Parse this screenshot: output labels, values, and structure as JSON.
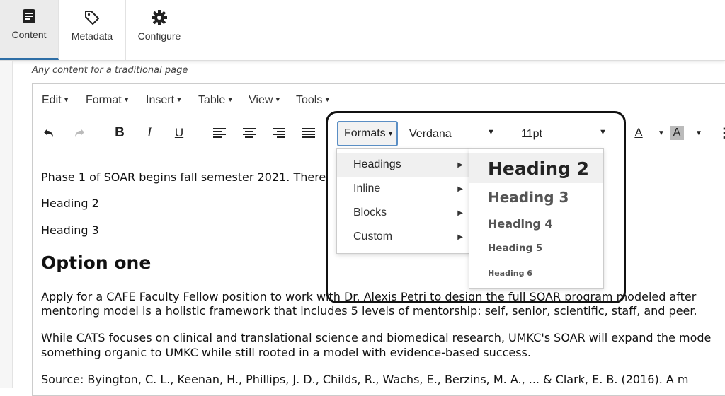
{
  "tabs": [
    {
      "label": "Content",
      "icon": "document-icon"
    },
    {
      "label": "Metadata",
      "icon": "tag-icon"
    },
    {
      "label": "Configure",
      "icon": "gear-icon"
    }
  ],
  "hint": "Any content for a traditional page",
  "menubar": [
    "Edit",
    "Format",
    "Insert",
    "Table",
    "View",
    "Tools"
  ],
  "toolbar": {
    "formats_label": "Formats",
    "font": "Verdana",
    "size": "11pt"
  },
  "content": {
    "p1": "Phase 1 of SOAR begins fall semester 2021. There",
    "heading2": "Heading 2",
    "heading3": "Heading 3",
    "option_one": "Option one",
    "p2a": "Apply for a CAFE Faculty Fellow position to work with Dr. Alexis Petri to design the full SOAR program modeled after",
    "p2b": "mentoring model is a holistic framework that includes 5 levels of mentorship: self, senior, scientific, staff, and peer.",
    "p3a": "While CATS focuses on clinical and translational science and biomedical research, UMKC's SOAR will expand the mode",
    "p3b": "something organic to UMKC while still rooted in a model with evidence-based success.",
    "p4": "Source: Byington, C. L., Keenan, H., Phillips, J. D., Childs, R., Wachs, E., Berzins, M. A., ... & Clark, E. B. (2016). A m"
  },
  "formats_menu": [
    "Headings",
    "Inline",
    "Blocks",
    "Custom"
  ],
  "headings_submenu": [
    "Heading 2",
    "Heading 3",
    "Heading 4",
    "Heading 5",
    "Heading 6"
  ]
}
